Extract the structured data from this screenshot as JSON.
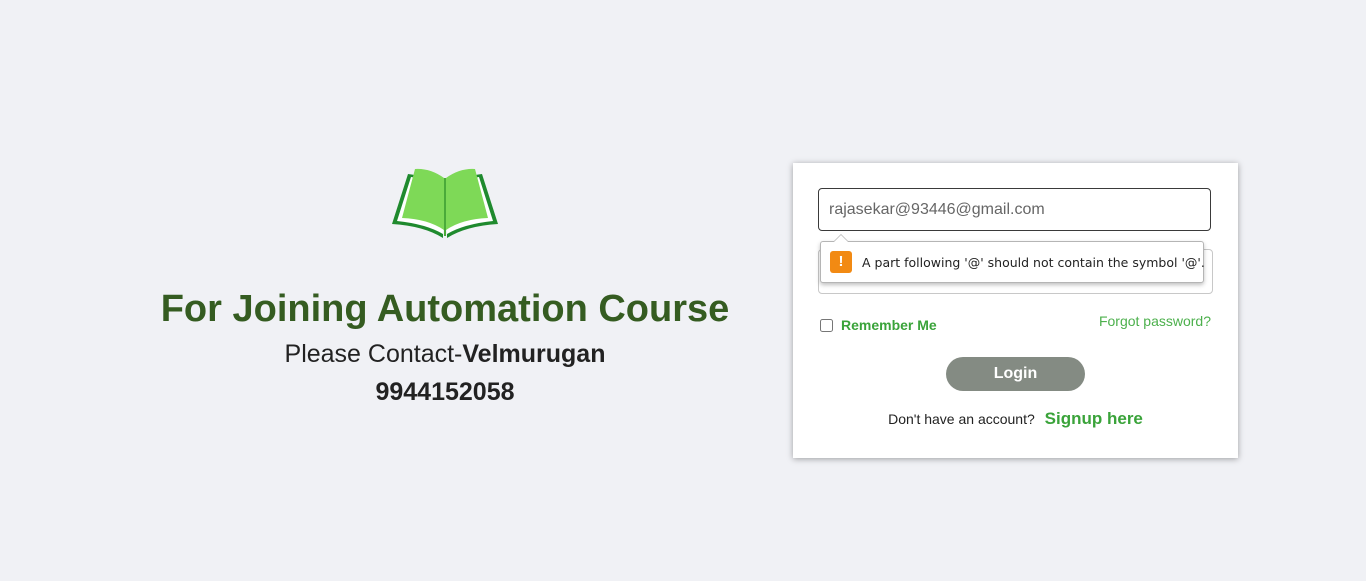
{
  "promo": {
    "logo_icon": "open-book-icon",
    "title": "For Joining Automation Course",
    "contact_prefix": "Please Contact-",
    "contact_name": "Velmurugan",
    "phone": "9944152058",
    "title_color": "#355c21"
  },
  "login": {
    "email_value": "rajasekar@93446@gmail.com",
    "password_value": "",
    "validation_message": "A part following '@' should not contain the symbol '@'.",
    "validation_icon": "warning-icon",
    "remember_label": "Remember Me",
    "remember_checked": false,
    "forgot_label": "Forgot password?",
    "login_label": "Login",
    "signup_prompt": "Don't have an account?",
    "signup_label": "Signup here",
    "accent_color": "#3aa33a",
    "button_color": "#848b83"
  }
}
